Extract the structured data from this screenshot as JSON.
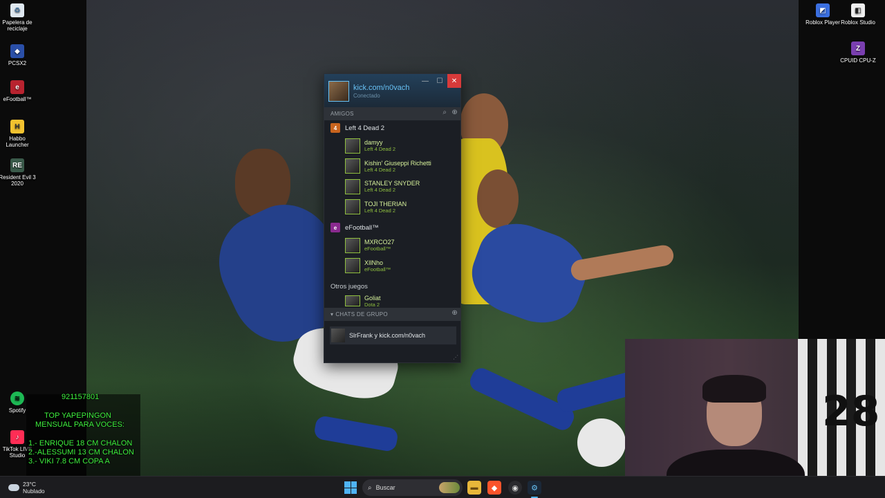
{
  "desktop": {
    "icons_left": [
      {
        "label": "Papelera de reciclaje",
        "icon": "recycle-bin-icon"
      },
      {
        "label": "PCSX2",
        "icon": "pcsx2-icon"
      },
      {
        "label": "eFootball™",
        "icon": "efootball-icon"
      },
      {
        "label": "Habbo Launcher",
        "icon": "habbo-icon"
      },
      {
        "label": "Resident Evil 3 2020",
        "icon": "resident-evil-icon"
      },
      {
        "label": "Spotify",
        "icon": "spotify-icon"
      },
      {
        "label": "TikTok LIVE Studio",
        "icon": "tiktok-icon"
      }
    ],
    "icons_right": [
      {
        "label": "Roblox Player",
        "icon": "roblox-icon"
      },
      {
        "label": "Roblox Studio",
        "icon": "roblox-studio-icon"
      },
      {
        "label": "CPUID CPU-Z",
        "icon": "cpuz-icon"
      }
    ]
  },
  "steam": {
    "user_name": "kick.com/n0vach",
    "user_status": "Conectado",
    "friends_header": "AMIGOS",
    "groups": [
      {
        "game": "Left 4 Dead 2",
        "friends": [
          {
            "name": "damyy",
            "game": "Left 4 Dead 2"
          },
          {
            "name": "Kishin' Giuseppi Richetti",
            "game": "Left 4 Dead 2"
          },
          {
            "name": "STANLEY SNYDER",
            "game": "Left 4 Dead 2"
          },
          {
            "name": "TOJI THERIAN",
            "game": "Left 4 Dead 2"
          }
        ]
      },
      {
        "game": "eFootball™",
        "friends": [
          {
            "name": "MXRCO27",
            "game": "eFootball™"
          },
          {
            "name": "XIlNho",
            "game": "eFootball™"
          }
        ]
      }
    ],
    "other_games_label": "Otros juegos",
    "other_friends": [
      {
        "name": "Goliat",
        "game": "Dota 2"
      }
    ],
    "group_chats_header": "CHATS DE GRUPO",
    "group_chat_item": "SlrFrank y kick.com/n0vach",
    "colors": {
      "in_game": "#8fbf3f",
      "online": "#67c1f5",
      "close": "#d83a3a"
    }
  },
  "overlay": {
    "phone": "921157801",
    "title_line1": "TOP YAPEPINGON",
    "title_line2": "MENSUAL PARA VOCES:",
    "line1": "1.- ENRIQUE 18 CM CHALON",
    "line2": "2.-ALESSUMI 13 CM CHALON",
    "line3": "3.- VIKI 7.8 CM COPA A"
  },
  "taskbar": {
    "temperature": "23°C",
    "weather": "Nublado",
    "search_placeholder": "Buscar"
  }
}
